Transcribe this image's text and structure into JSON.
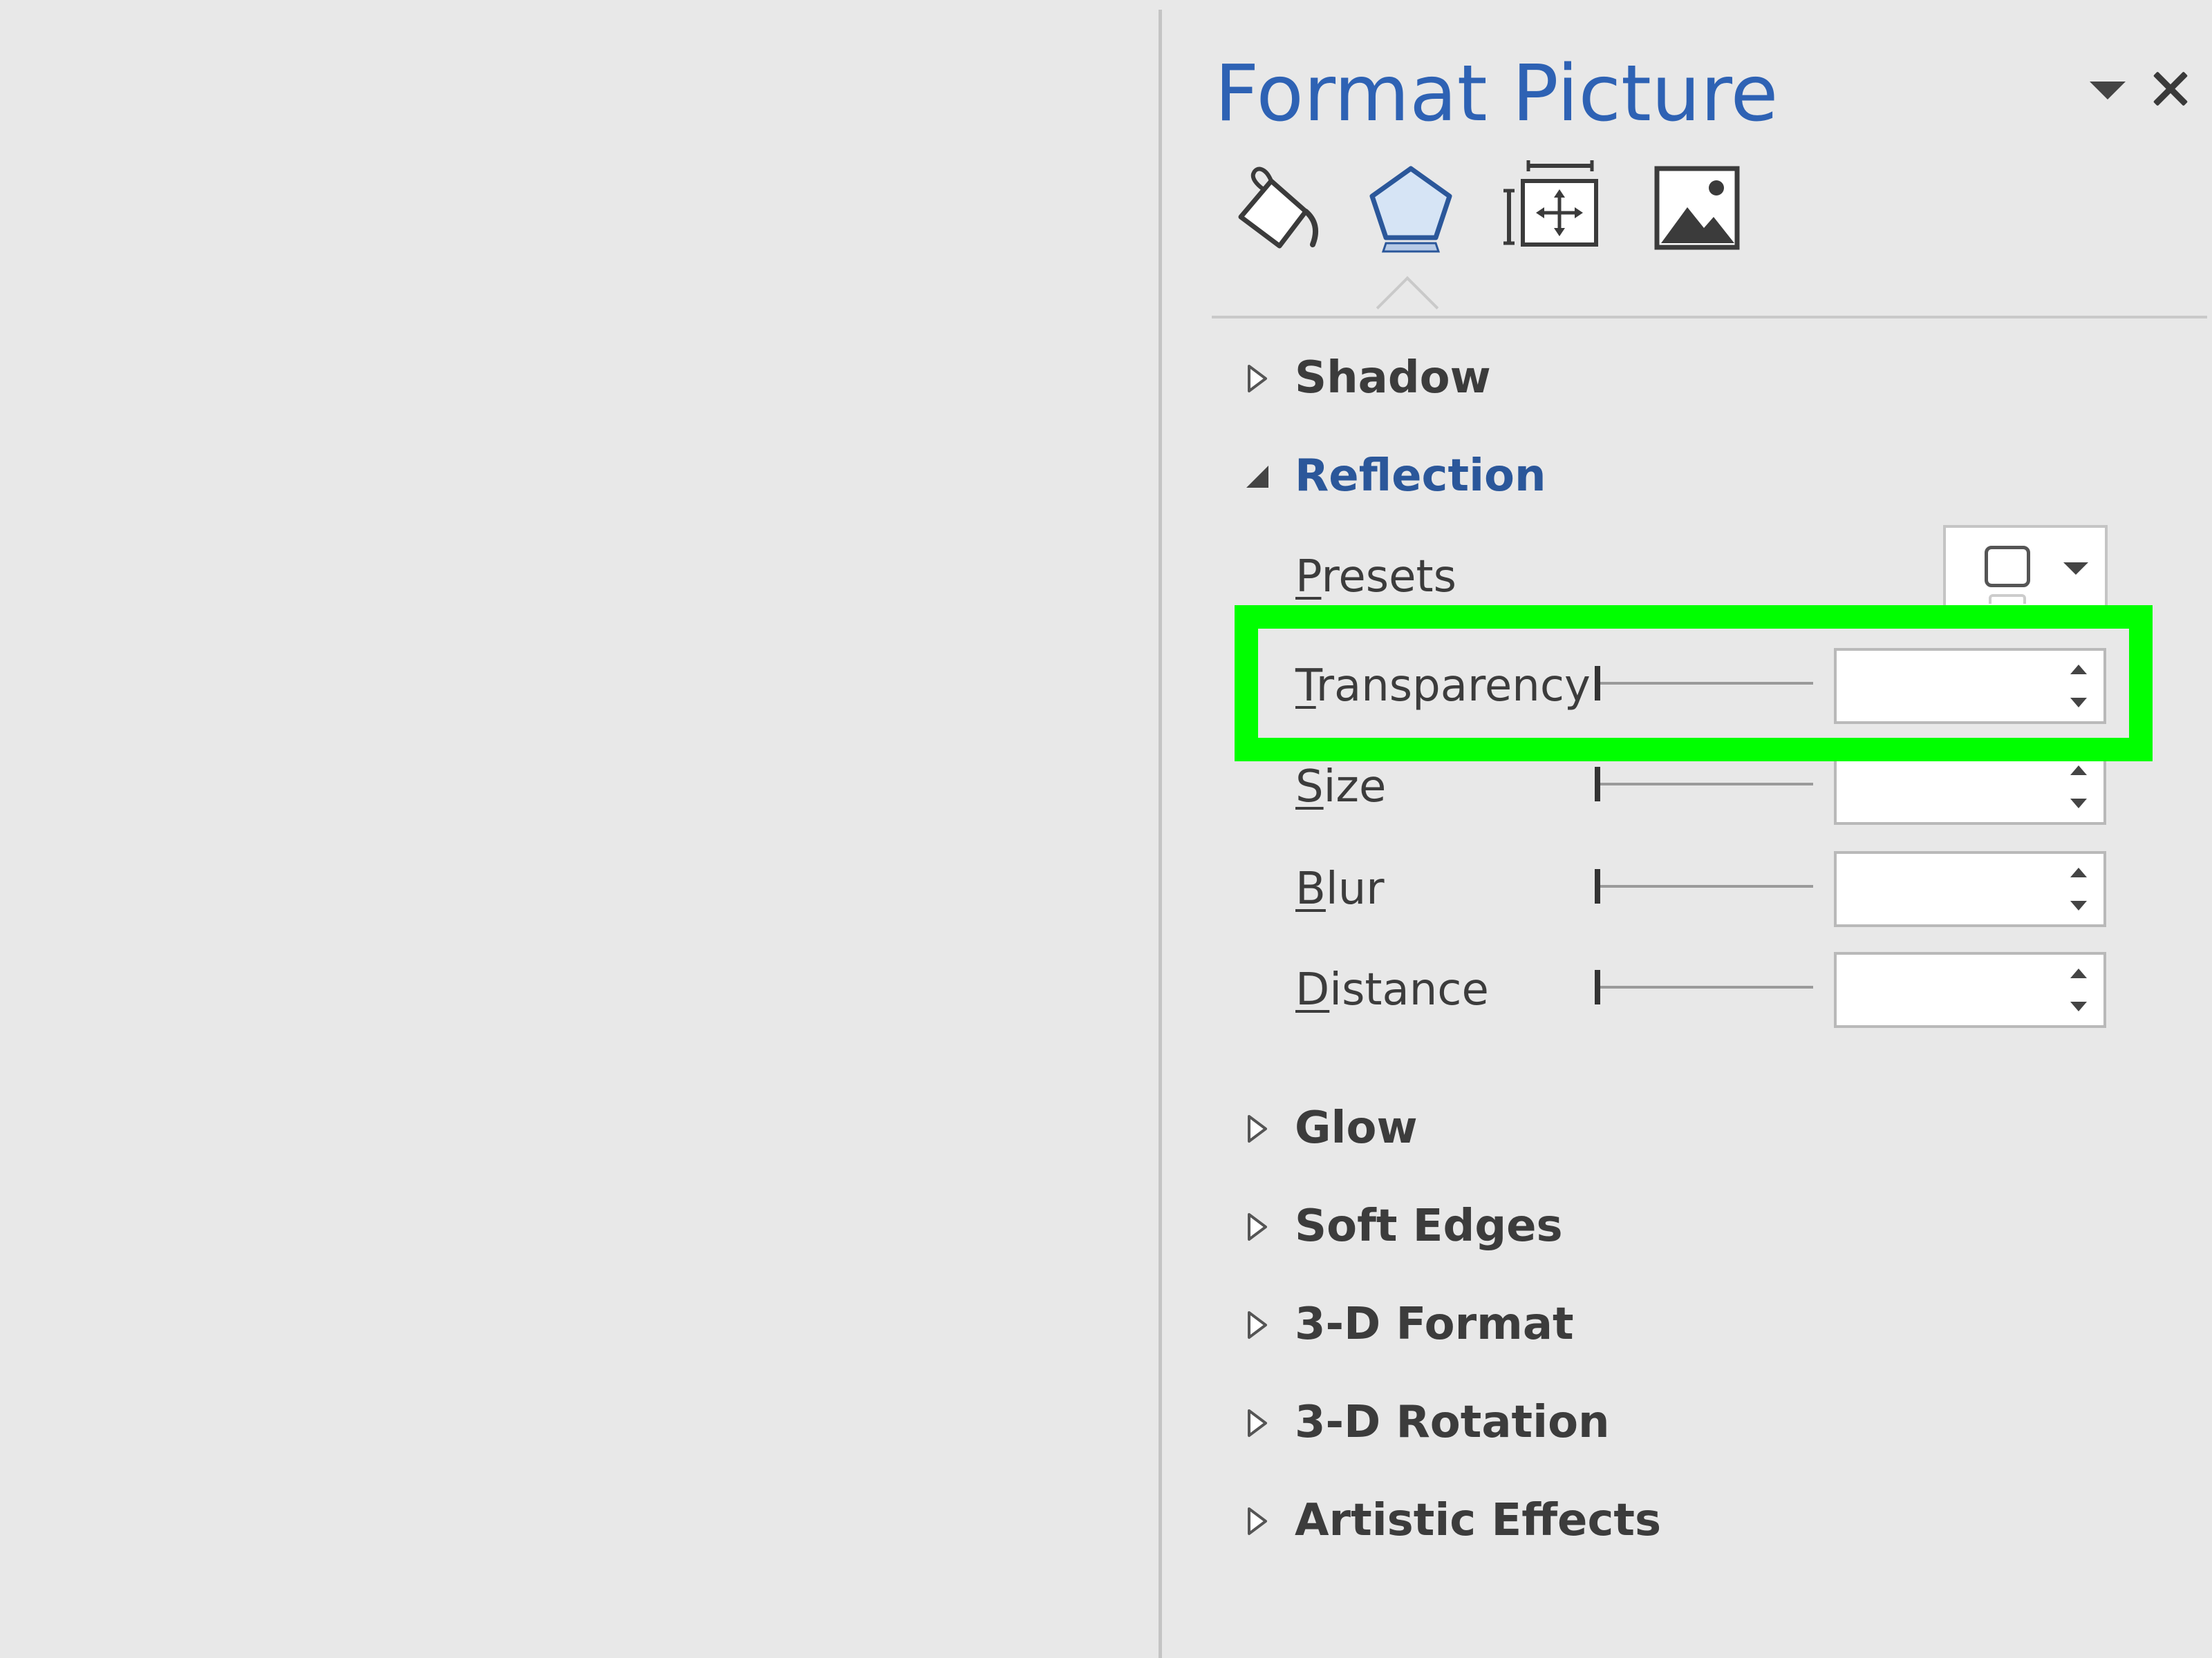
{
  "pane": {
    "title": "Format Picture",
    "accent_color": "#2e62b4",
    "tabs": [
      {
        "name": "Fill & Line",
        "icon": "paint-bucket-icon"
      },
      {
        "name": "Effects",
        "icon": "pentagon-icon",
        "selected": true
      },
      {
        "name": "Layout & Properties",
        "icon": "size-position-icon"
      },
      {
        "name": "Picture",
        "icon": "picture-icon"
      }
    ]
  },
  "sections": {
    "shadow": "Shadow",
    "reflection": "Reflection",
    "glow": "Glow",
    "soft_edges": "Soft Edges",
    "format_3d": "3-D Format",
    "rotation_3d": "3-D Rotation",
    "artistic_effects": "Artistic Effects"
  },
  "reflection": {
    "presets": {
      "label_key": "P",
      "label_rest": "resets"
    },
    "transparency": {
      "label_key": "T",
      "label_rest": "ransparency",
      "value": ""
    },
    "size": {
      "label_key": "S",
      "label_rest": "ize",
      "value": ""
    },
    "blur": {
      "label_key": "B",
      "label_rest": "lur",
      "value": ""
    },
    "distance": {
      "label_key": "D",
      "label_rest": "istance",
      "value": ""
    }
  },
  "highlight": {
    "color": "#00ff00",
    "target": "transparency-row"
  }
}
